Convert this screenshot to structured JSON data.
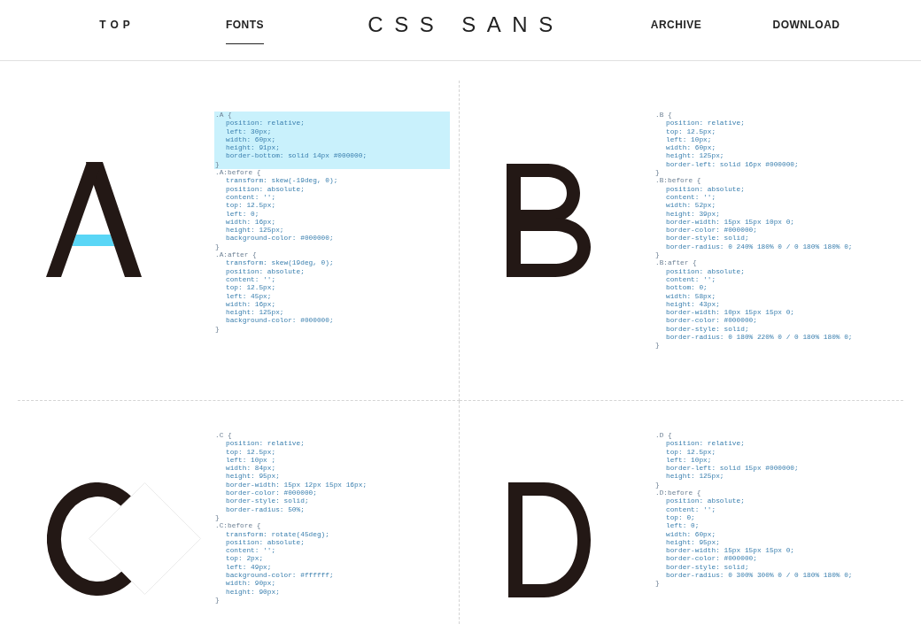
{
  "header": {
    "left_links": [
      {
        "label": "TOP",
        "selected": false
      },
      {
        "label": "FONTS",
        "selected": true
      }
    ],
    "logo": "CSS SANS",
    "right_links": [
      {
        "label": "ARCHIVE",
        "selected": false
      },
      {
        "label": "DOWNLOAD",
        "selected": false
      }
    ]
  },
  "panels": [
    {
      "kind": "A",
      "rules": [
        {
          "open": ".A {",
          "lines": [
            "position: relative;",
            "left: 30px;",
            "width: 60px;",
            "height: 91px;",
            "border-bottom: solid 14px #000000;"
          ],
          "close": "}",
          "selected": true
        },
        {
          "open": ".A:before {",
          "lines": [
            "transform: skew(-19deg, 0);",
            "position: absolute;",
            "content: '';",
            "top: 12.5px;",
            "left: 0;",
            "width: 16px;",
            "height: 125px;",
            "background-color: #000000;"
          ],
          "close": "}",
          "selected": false
        },
        {
          "open": ".A:after {",
          "lines": [
            "transform: skew(19deg, 0);",
            "position: absolute;",
            "content: '';",
            "top: 12.5px;",
            "left: 45px;",
            "width: 16px;",
            "height: 125px;",
            "background-color: #000000;"
          ],
          "close": "}",
          "selected": false
        }
      ]
    },
    {
      "kind": "B",
      "rules": [
        {
          "open": ".B {",
          "lines": [
            "position: relative;",
            "top: 12.5px;",
            "left: 10px;",
            "width: 60px;",
            "height: 125px;",
            "border-left: solid 16px #000000;"
          ],
          "close": "}",
          "selected": false
        },
        {
          "open": ".B:before {",
          "lines": [
            "position: absolute;",
            "content: '';",
            "width: 52px;",
            "height: 39px;",
            "border-width: 15px 15px 10px 0;",
            "border-color: #000000;",
            "border-style: solid;",
            "border-radius: 0 240% 180% 0 / 0 180% 180% 0;"
          ],
          "close": "}",
          "selected": false
        },
        {
          "open": ".B:after {",
          "lines": [
            "position: absolute;",
            "content: '';",
            "bottom: 0;",
            "width: 58px;",
            "height: 43px;",
            "border-width: 10px 15px 15px 0;",
            "border-color: #000000;",
            "border-style: solid;",
            "border-radius: 0 180% 220% 0 / 0 180% 180% 0;"
          ],
          "close": "}",
          "selected": false
        }
      ]
    },
    {
      "kind": "C",
      "rules": [
        {
          "open": ".C {",
          "lines": [
            "position: relative;",
            "top: 12.5px;",
            "left: 10px ;",
            "width: 84px;",
            "height: 95px;",
            "border-width: 15px 12px 15px 16px;",
            "border-color: #000000;",
            "border-style: solid;",
            "border-radius: 50%;"
          ],
          "close": "}",
          "selected": false
        },
        {
          "open": ".C:before {",
          "lines": [
            "transform: rotate(45deg);",
            "position: absolute;",
            "content: '';",
            "top: 2px;",
            "left: 49px;",
            "background-color: #ffffff;",
            "width: 90px;",
            "height: 90px;"
          ],
          "close": "}",
          "selected": false
        }
      ]
    },
    {
      "kind": "D",
      "rules": [
        {
          "open": ".D {",
          "lines": [
            "position: relative;",
            "top: 12.5px;",
            "left: 10px;",
            "border-left: solid 15px #000000;",
            "height: 125px;"
          ],
          "close": "}",
          "selected": false
        },
        {
          "open": ".D:before {",
          "lines": [
            "position: absolute;",
            "content: '';",
            "top: 0;",
            "left: 0;",
            "width: 60px;",
            "height: 95px;",
            "border-width: 15px 15px 15px 0;",
            "border-color: #000000;",
            "border-style: solid;",
            "border-radius: 0 300% 300% 0 / 0 180% 180% 0;"
          ],
          "close": "}",
          "selected": false
        }
      ]
    }
  ]
}
